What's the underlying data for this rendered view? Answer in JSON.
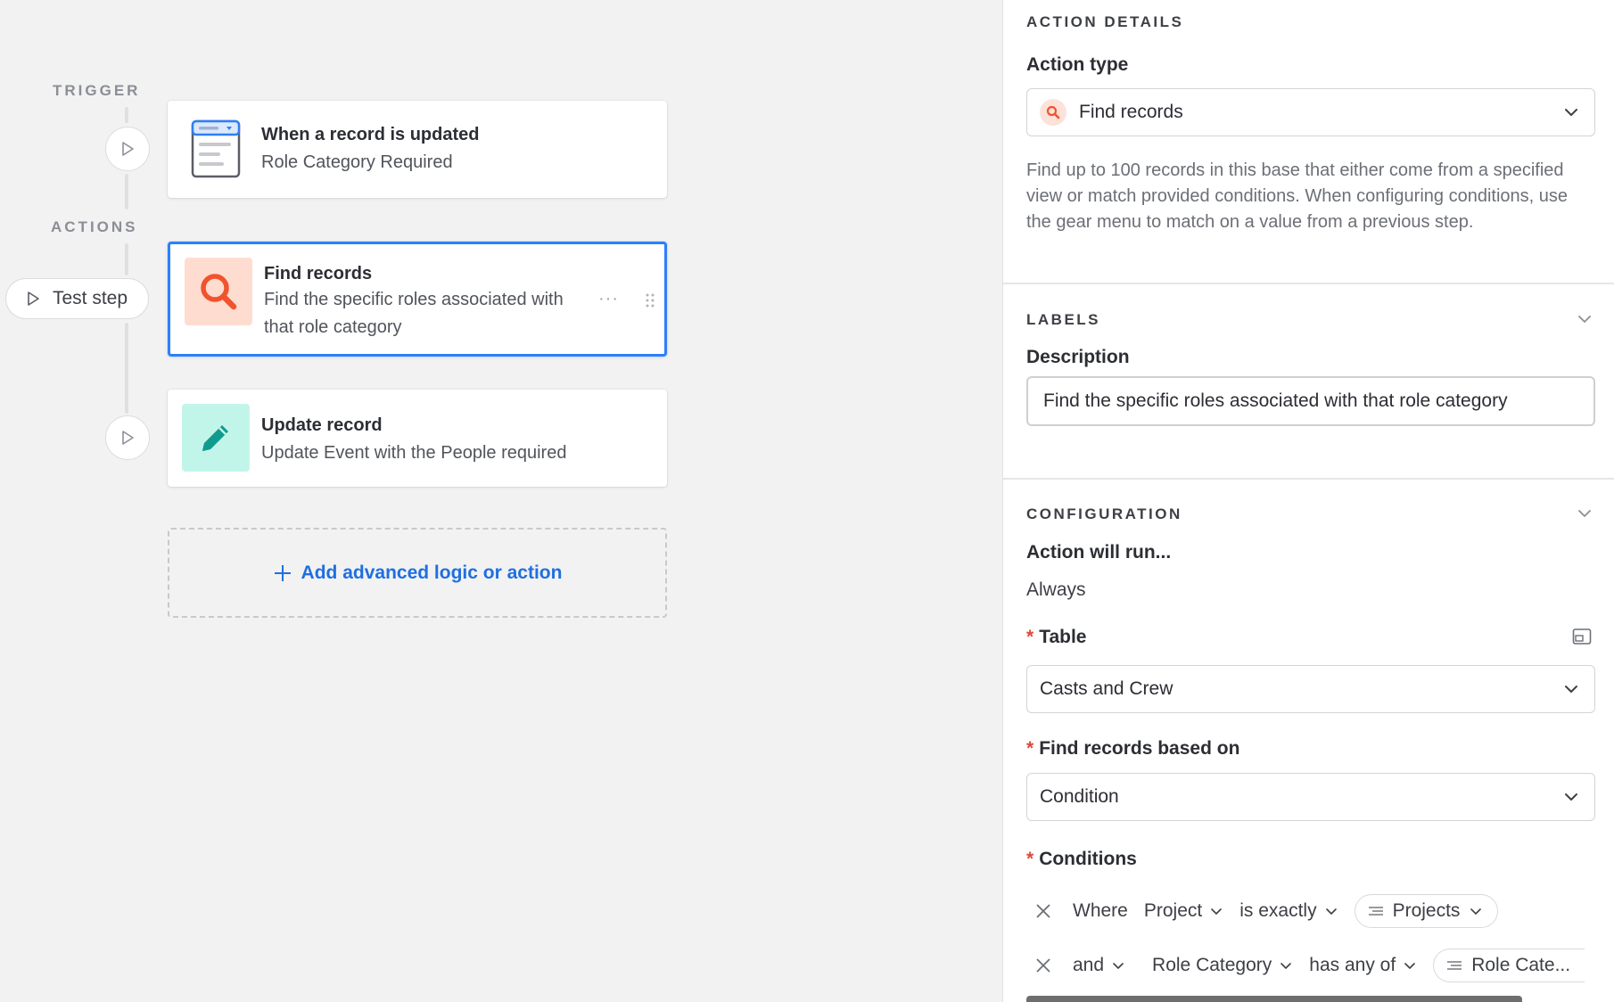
{
  "canvas": {
    "trigger_label": "TRIGGER",
    "actions_label": "ACTIONS",
    "test_step_label": "Test step",
    "trigger_card": {
      "title": "When a record is updated",
      "subtitle": "Role Category Required",
      "icon": "record-updated-form-icon"
    },
    "action_cards": [
      {
        "title": "Find records",
        "subtitle": "Find the specific roles associated with that role category",
        "icon": "search-icon",
        "icon_bg": "#ffdcd0",
        "icon_color": "#f0532e",
        "selected": true,
        "more": "···"
      },
      {
        "title": "Update record",
        "subtitle": "Update Event with the People required",
        "icon": "pencil-icon",
        "icon_bg": "#c2f5e9",
        "icon_color": "#0f9b8e",
        "selected": false
      }
    ],
    "add_action_label": "Add advanced logic or action"
  },
  "panel": {
    "action_details_heading": "ACTION DETAILS",
    "action_type_label": "Action type",
    "action_type_value": "Find records",
    "action_type_description": "Find up to 100 records in this base that either come from a specified view or match provided conditions. When configuring conditions, use the gear menu to match on a value from a previous step.",
    "labels_heading": "LABELS",
    "description_label": "Description",
    "description_value": "Find the specific roles associated with that role category",
    "configuration_heading": "CONFIGURATION",
    "action_will_run_label": "Action will run...",
    "action_will_run_value": "Always",
    "required_marker": "*",
    "table_label": "Table",
    "table_value": "Casts and Crew",
    "find_based_on_label": "Find records based on",
    "find_based_on_value": "Condition",
    "conditions_label": "Conditions",
    "conditions": [
      {
        "conjunction": "Where",
        "field": "Project",
        "operator": "is exactly",
        "value": "Projects"
      },
      {
        "conjunction": "and",
        "field": "Role Category",
        "operator": "has any of",
        "value": "Role Cate..."
      }
    ]
  },
  "colors": {
    "accent": "#2d7ff9",
    "link": "#1f6fe0",
    "required": "#e0483a"
  }
}
